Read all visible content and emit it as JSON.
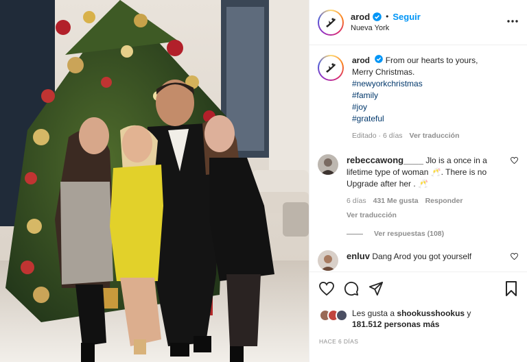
{
  "post": {
    "username": "arod",
    "follow_label": "Seguir",
    "separator": "•",
    "location": "Nueva York",
    "more_label": "•••",
    "caption": {
      "username": "arod",
      "text_line1": "From our hearts to yours,",
      "text_line2": "Merry Christmas.",
      "hashtags": [
        "#newyorkchristmas",
        "#family",
        "#joy",
        "#grateful"
      ],
      "edited": "Editado · 6 días",
      "translate": "Ver traducción"
    },
    "comments": [
      {
        "username": "rebeccawong____",
        "text": "Jlo is a once in a lifetime type of woman 🥂. There is no Upgrade after her . 🥂",
        "time": "6 días",
        "likes": "431 Me gusta",
        "reply": "Responder",
        "translate": "Ver traducción",
        "view_replies": "Ver respuestas (108)"
      },
      {
        "username": "enluv",
        "text": "Dang Arod you got yourself"
      }
    ],
    "likes_text": {
      "prefix": "Les gusta a",
      "user": "shookusshookus",
      "connector": "y",
      "count": "181.512 personas más"
    },
    "timestamp": "HACE 6 DÍAS"
  },
  "icons": {
    "verified": "verified-badge-icon",
    "more": "more-options-icon",
    "like": "heart-icon",
    "comment": "comment-icon",
    "share": "paper-plane-icon",
    "save": "bookmark-icon"
  },
  "colors": {
    "accent": "#0095f6",
    "hashtag": "#00376b",
    "muted": "#8e8e8e",
    "divider": "#efefef"
  }
}
